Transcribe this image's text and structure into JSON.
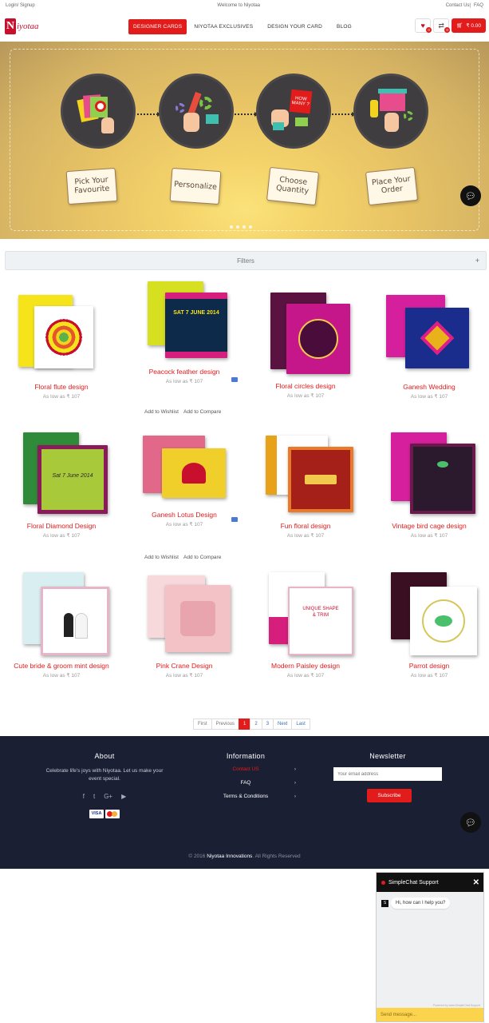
{
  "topbar": {
    "left": "Login/ Signup",
    "center": "Welcome to Niyotaa",
    "contact": "Contact Us",
    "faq": "FAQ"
  },
  "logo": {
    "mark": "N",
    "word": "iyotaa"
  },
  "nav": [
    {
      "label": "DESIGNER CARDS",
      "active": true
    },
    {
      "label": "NIYOTAA EXCLUSIVES"
    },
    {
      "label": "DESIGN YOUR CARD"
    },
    {
      "label": "BLOG"
    }
  ],
  "header": {
    "wishlist_count": "0",
    "compare_count": "0",
    "cart_count": "0",
    "cart_total": "₹ 0.00"
  },
  "hero": {
    "steps": [
      "Pick Your Favourite",
      "Personalize",
      "Choose Quantity",
      "Place Your Order"
    ],
    "step3_sign": "HOW MANY ?"
  },
  "filters": {
    "label": "Filters",
    "toggle": "+"
  },
  "products": [
    {
      "name": "Floral flute design",
      "price": "As low as  ₹ 107"
    },
    {
      "name": "Peacock feather design",
      "price": "As low as  ₹ 107"
    },
    {
      "name": "Floral circles design",
      "price": "As low as  ₹ 107"
    },
    {
      "name": "Ganesh Wedding",
      "price": "As low as  ₹ 107"
    },
    {
      "name": "Floral Diamond Design",
      "price": "As low as  ₹ 107"
    },
    {
      "name": "Ganesh Lotus Design",
      "price": "As low as  ₹ 107"
    },
    {
      "name": "Fun floral design",
      "price": "As low as  ₹ 107"
    },
    {
      "name": "Vintage bird cage design",
      "price": "As low as  ₹ 107"
    },
    {
      "name": "Cute bride & groom mint design",
      "price": "As low as  ₹ 107"
    },
    {
      "name": "Pink Crane Design",
      "price": "As low as  ₹ 107"
    },
    {
      "name": "Modern Paisley design",
      "price": "As low as  ₹ 107"
    },
    {
      "name": "Parrot design",
      "price": "As low as  ₹ 107"
    }
  ],
  "actions": {
    "wishlist": "Add to Wishlist",
    "compare": "Add to Compare"
  },
  "pagination": [
    "First",
    "Previous",
    "1",
    "2",
    "3",
    "Next",
    "Last"
  ],
  "footer": {
    "about_title": "About",
    "about_text": "Celebrate life's joys with Niyotaa. Let us make your event special.",
    "info_title": "Information",
    "links": [
      "Contact US",
      "FAQ",
      "Terms & Conditions"
    ],
    "newsletter_title": "Newsletter",
    "newsletter_placeholder": "Your email address",
    "subscribe": "Subscribe",
    "payment": {
      "visa": "VISA"
    },
    "copyright_prefix": "© 2016",
    "copyright_brand": "Niyotaa Innovations",
    "copyright_suffix": ". All Rights Reserved"
  },
  "chat": {
    "title": "SimpleChat Support",
    "greeting": "Hi, how can I help you?",
    "placeholder": "Send message...",
    "powered": "Powered by www.SimpleChat.Support"
  },
  "colors": {
    "accent": "#e21b1b",
    "footer": "#1b1f33",
    "product_name": "#e21b1b"
  }
}
